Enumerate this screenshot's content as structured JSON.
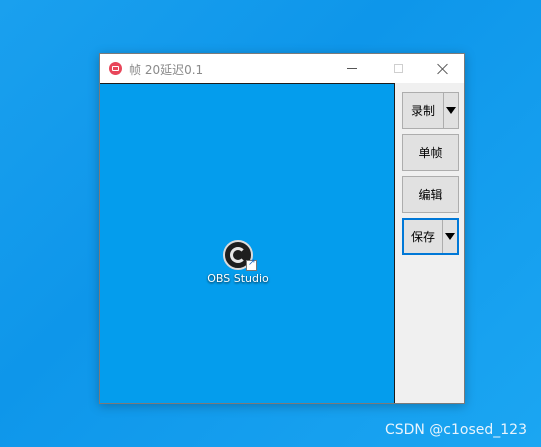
{
  "window": {
    "title": "帧 20延迟0.1",
    "accent_color": "#e8465a"
  },
  "capture_area": {
    "background_color": "#049ded",
    "desktop_icon": {
      "label": "OBS Studio",
      "icon": "obs-studio-icon"
    }
  },
  "side_panel": {
    "record_label": "录制",
    "single_frame_label": "单帧",
    "edit_label": "编辑",
    "save_label": "保存"
  },
  "watermark": {
    "text": "CSDN @c1osed_123"
  }
}
